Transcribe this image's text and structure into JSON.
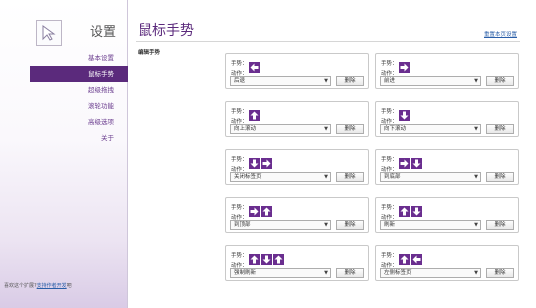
{
  "sidebar": {
    "title": "设置",
    "items": [
      {
        "label": "基本设置",
        "active": false
      },
      {
        "label": "鼠标手势",
        "active": true
      },
      {
        "label": "超级拖拽",
        "active": false
      },
      {
        "label": "滚轮功能",
        "active": false
      },
      {
        "label": "高级选项",
        "active": false
      },
      {
        "label": "关于",
        "active": false
      }
    ],
    "footer_text": "喜欢这个扩展?",
    "footer_link": "支持作者开发",
    "footer_end": "吧"
  },
  "header": {
    "title": "鼠标手势",
    "reset_link": "重置本页设置"
  },
  "section": {
    "label": "编辑手势"
  },
  "colors": {
    "accent": "#5b2a7c",
    "arrow": "#6a2e8f",
    "link": "#2a5ea8"
  },
  "gesture_label": "手势：",
  "action_label": "动作：",
  "delete_label": "删除",
  "gestures": [
    {
      "arrows": [
        "left"
      ],
      "action": "后退"
    },
    {
      "arrows": [
        "right"
      ],
      "action": "前进"
    },
    {
      "arrows": [
        "up"
      ],
      "action": "向上滚动"
    },
    {
      "arrows": [
        "down"
      ],
      "action": "向下滚动"
    },
    {
      "arrows": [
        "down",
        "right"
      ],
      "action": "关闭标签页"
    },
    {
      "arrows": [
        "right",
        "down"
      ],
      "action": "到底部"
    },
    {
      "arrows": [
        "right",
        "up"
      ],
      "action": "到顶部"
    },
    {
      "arrows": [
        "up",
        "down"
      ],
      "action": "刷新"
    },
    {
      "arrows": [
        "up",
        "down",
        "up"
      ],
      "action": "强制刷新"
    },
    {
      "arrows": [
        "up",
        "left"
      ],
      "action": "左侧标签页"
    }
  ]
}
